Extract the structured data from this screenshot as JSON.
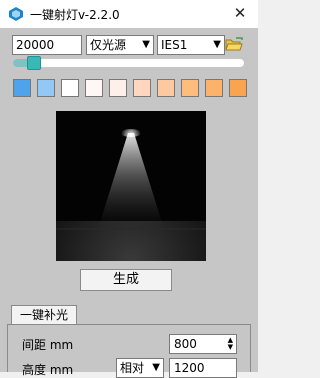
{
  "window": {
    "title": "一键射灯v-2.2.0",
    "close_label": "✕"
  },
  "toolbar": {
    "intensity_value": "20000",
    "source_select": "仅光源",
    "ies_select": "IES1",
    "slider_fraction": 0.09
  },
  "swatches": [
    "#4ea3ea",
    "#93c8f4",
    "#ffffff",
    "#fff7f5",
    "#ffefea",
    "#ffd7c1",
    "#fdc9a0",
    "#fdbd7d",
    "#fcb26a",
    "#f9a54f"
  ],
  "generate_label": "生成",
  "tabs": [
    {
      "label": "一键补光"
    }
  ],
  "settings": {
    "spacing_label": "间距 mm",
    "spacing_value": "800",
    "height_label": "高度 mm",
    "height_mode": "相对",
    "height_value": "1200"
  }
}
